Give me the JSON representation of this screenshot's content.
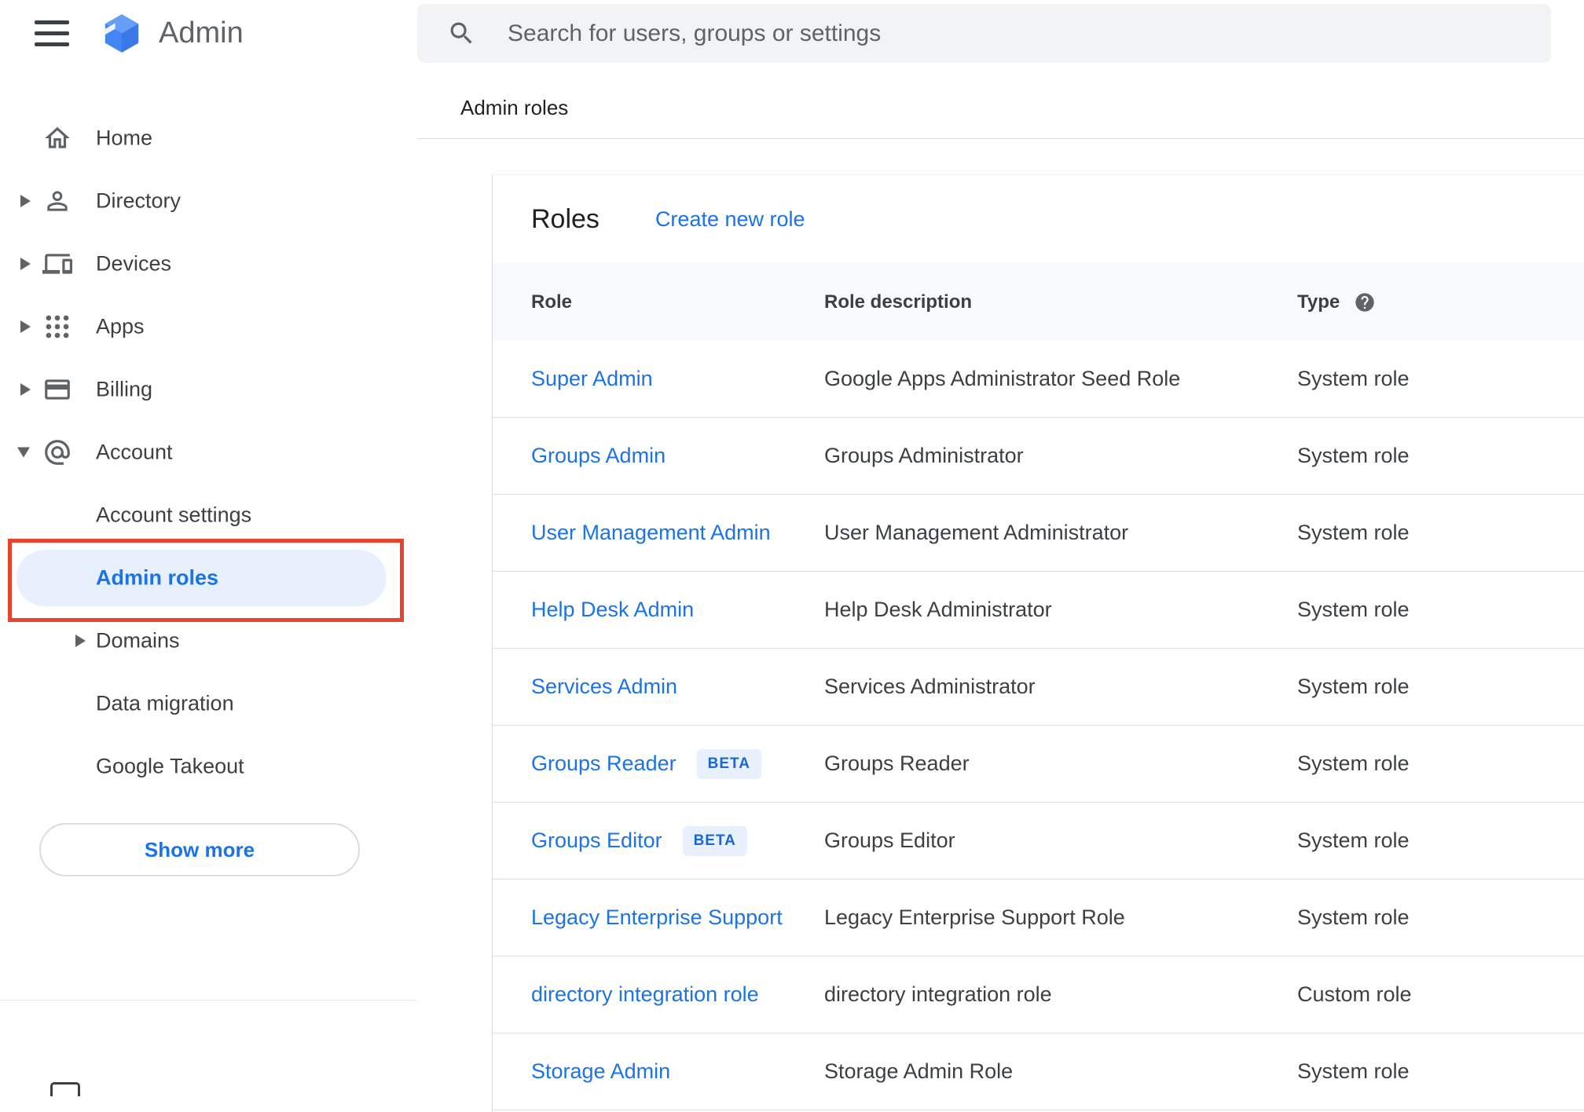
{
  "topbar": {
    "app_title": "Admin",
    "search_placeholder": "Search for users, groups or settings"
  },
  "breadcrumb": "Admin roles",
  "sidebar": {
    "items": [
      {
        "label": "Home"
      },
      {
        "label": "Directory"
      },
      {
        "label": "Devices"
      },
      {
        "label": "Apps"
      },
      {
        "label": "Billing"
      },
      {
        "label": "Account"
      },
      {
        "label": "Account settings"
      },
      {
        "label": "Admin roles"
      },
      {
        "label": "Domains"
      },
      {
        "label": "Data migration"
      },
      {
        "label": "Google Takeout"
      }
    ],
    "show_more": "Show more"
  },
  "roles": {
    "heading": "Roles",
    "create_link": "Create new role",
    "columns": {
      "role": "Role",
      "description": "Role description",
      "type": "Type"
    },
    "rows": [
      {
        "role": "Super Admin",
        "description": "Google Apps Administrator Seed Role",
        "type": "System role"
      },
      {
        "role": "Groups Admin",
        "description": "Groups Administrator",
        "type": "System role"
      },
      {
        "role": "User Management Admin",
        "description": "User Management Administrator",
        "type": "System role"
      },
      {
        "role": "Help Desk Admin",
        "description": "Help Desk Administrator",
        "type": "System role"
      },
      {
        "role": "Services Admin",
        "description": "Services Administrator",
        "type": "System role"
      },
      {
        "role": "Groups Reader",
        "badge": "BETA",
        "description": "Groups Reader",
        "type": "System role"
      },
      {
        "role": "Groups Editor",
        "badge": "BETA",
        "description": "Groups Editor",
        "type": "System role"
      },
      {
        "role": "Legacy Enterprise Support",
        "description": "Legacy Enterprise Support Role",
        "type": "System role"
      },
      {
        "role": "directory integration role",
        "description": "directory integration role",
        "type": "Custom role"
      },
      {
        "role": "Storage Admin",
        "description": "Storage Admin Role",
        "type": "System role"
      }
    ]
  },
  "colors": {
    "accent": "#1a73e8",
    "selected_bg": "#e8f0fe",
    "annotation_red": "#e8442d",
    "beta_bg": "#e8f0fe",
    "beta_text": "#1967d2",
    "header_row_bg": "#f8f9fa"
  }
}
